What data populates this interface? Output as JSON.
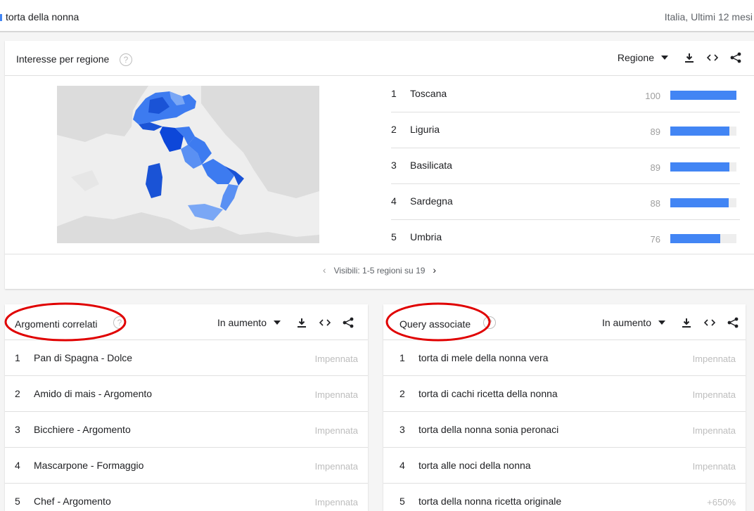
{
  "top_bar": {
    "term": "torta della nonna",
    "scope": "Italia, Ultimi 12 mesi"
  },
  "region_card": {
    "title": "Interesse per regione",
    "help": "?",
    "selector": "Regione",
    "rows": [
      {
        "rank": "1",
        "name": "Toscana",
        "value": "100",
        "fraction": 1.0
      },
      {
        "rank": "2",
        "name": "Liguria",
        "value": "89",
        "fraction": 0.89
      },
      {
        "rank": "3",
        "name": "Basilicata",
        "value": "89",
        "fraction": 0.89
      },
      {
        "rank": "4",
        "name": "Sardegna",
        "value": "88",
        "fraction": 0.88
      },
      {
        "rank": "5",
        "name": "Umbria",
        "value": "76",
        "fraction": 0.76
      }
    ],
    "pager": "Visibili: 1-5 regioni su 19"
  },
  "topics_card": {
    "title": "Argomenti correlati",
    "help": "?",
    "selector": "In aumento",
    "rows": [
      {
        "rank": "1",
        "name": "Pan di Spagna - Dolce",
        "value": "Impennata"
      },
      {
        "rank": "2",
        "name": "Amido di mais - Argomento",
        "value": "Impennata"
      },
      {
        "rank": "3",
        "name": "Bicchiere - Argomento",
        "value": "Impennata"
      },
      {
        "rank": "4",
        "name": "Mascarpone - Formaggio",
        "value": "Impennata"
      },
      {
        "rank": "5",
        "name": "Chef - Argomento",
        "value": "Impennata"
      }
    ]
  },
  "queries_card": {
    "title": "Query associate",
    "help": "?",
    "selector": "In aumento",
    "rows": [
      {
        "rank": "1",
        "name": "torta di mele della nonna vera",
        "value": "Impennata"
      },
      {
        "rank": "2",
        "name": "torta di cachi ricetta della nonna",
        "value": "Impennata"
      },
      {
        "rank": "3",
        "name": "torta della nonna sonia peronaci",
        "value": "Impennata"
      },
      {
        "rank": "4",
        "name": "torta alle noci della nonna",
        "value": "Impennata"
      },
      {
        "rank": "5",
        "name": "torta della nonna ricetta originale",
        "value": "+650%"
      }
    ]
  },
  "colors": {
    "accent": "#4285f4",
    "map_dark": "#1a53d6",
    "map_mid": "#3d7bf0",
    "map_light": "#7aa7f5",
    "map_land": "#dcdcdc",
    "annotation": "#e00000"
  },
  "icons": [
    "dropdown-caret-icon",
    "download-icon",
    "embed-icon",
    "share-icon",
    "help-icon",
    "chevron-left-icon",
    "chevron-right-icon"
  ]
}
